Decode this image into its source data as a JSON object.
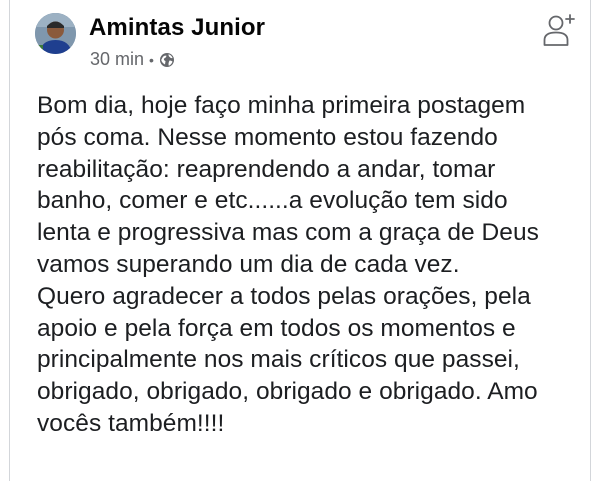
{
  "post": {
    "author": "Amintas Junior",
    "time": "30 min",
    "separator": "•",
    "visibility_icon": "globe-icon",
    "action_icon": "add-friend-icon",
    "lines": [
      "Bom dia, hoje faço minha primeira postagem",
      "pós coma. Nesse momento estou fazendo",
      "reabilitação: reaprendendo a andar, tomar",
      "banho, comer e etc......a evolução tem sido",
      "lenta e progressiva mas com a graça de Deus",
      "vamos superando um dia de cada vez.",
      "Quero agradecer a todos pelas orações, pela",
      "apoio e pela força em todos os momentos e",
      "principalmente nos mais críticos que passei,",
      "obrigado, obrigado, obrigado e obrigado. Amo",
      "vocês também!!!!"
    ]
  },
  "colors": {
    "author": "#050505",
    "meta": "#65676b",
    "text": "#1c1e21",
    "border": "#d3d6da"
  }
}
